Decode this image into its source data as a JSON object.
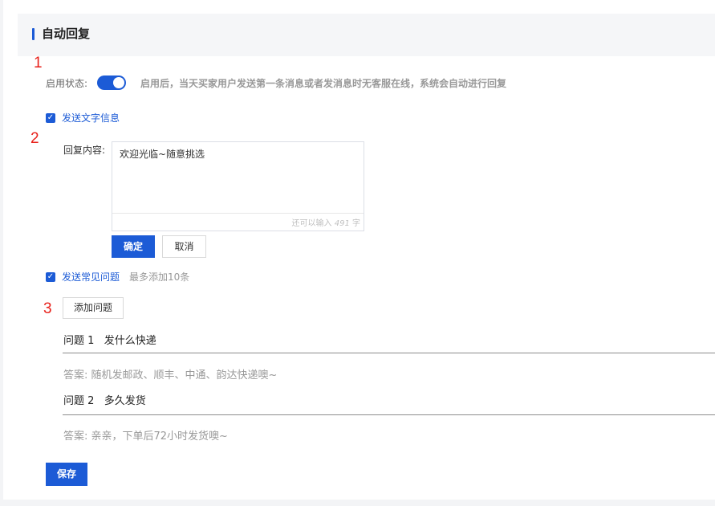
{
  "header": {
    "title": "自动回复"
  },
  "annotations": [
    "1",
    "2",
    "3"
  ],
  "status": {
    "label": "启用状态:",
    "enabled": true,
    "description": "启用后，当天买家用户发送第一条消息或者发消息时无客服在线，系统会自动进行回复"
  },
  "text_message": {
    "checkbox_label": "发送文字信息",
    "checked": true,
    "reply_label": "回复内容:",
    "reply_value": "欢迎光临~随意挑选",
    "counter_prefix": "还可以输入",
    "counter_value": "491",
    "counter_suffix": "字",
    "confirm_label": "确定",
    "cancel_label": "取消"
  },
  "faq": {
    "checkbox_label": "发送常见问题",
    "checked": true,
    "hint": "最多添加10条",
    "add_label": "添加问题",
    "items": [
      {
        "question": "问题 1   发什么快递",
        "answer": "答案: 随机发邮政、顺丰、中通、韵达快递噢~"
      },
      {
        "question": "问题 2   多久发货",
        "answer": "答案: 亲亲，下单后72小时发货噢~"
      }
    ]
  },
  "save_label": "保存",
  "colors": {
    "accent": "#1c5bd6",
    "annotation": "#e8211b"
  },
  "icons": {
    "checkbox": "check-icon"
  }
}
